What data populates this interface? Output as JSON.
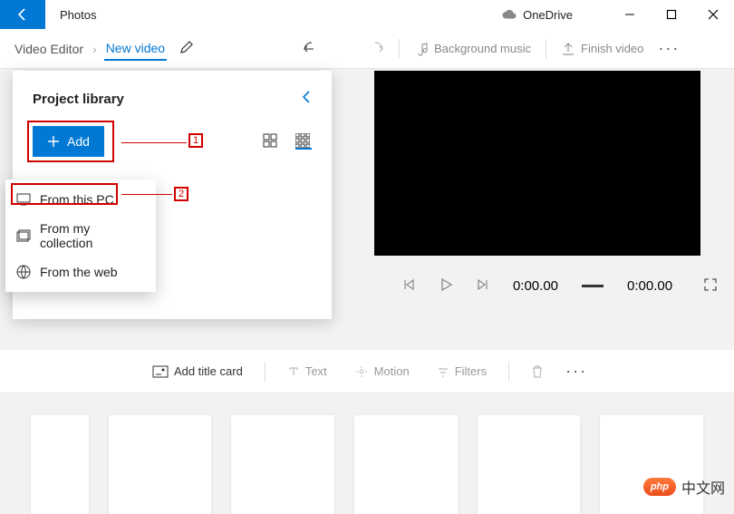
{
  "titlebar": {
    "app_name": "Photos",
    "cloud_label": "OneDrive"
  },
  "toolbar": {
    "crumb_root": "Video Editor",
    "crumb_current": "New video",
    "bg_music": "Background music",
    "finish": "Finish video"
  },
  "library": {
    "title": "Project library",
    "add_label": "Add"
  },
  "annotations": {
    "step1": "1",
    "step2": "2"
  },
  "context_menu": {
    "from_pc": "From this PC",
    "from_collection": "From my collection",
    "from_web": "From the web"
  },
  "playback": {
    "current_time": "0:00.00",
    "total_time": "0:00.00"
  },
  "clip_toolbar": {
    "add_title": "Add title card",
    "text": "Text",
    "motion": "Motion",
    "filters": "Filters"
  },
  "watermark": {
    "badge": "php",
    "text": "中文网"
  }
}
